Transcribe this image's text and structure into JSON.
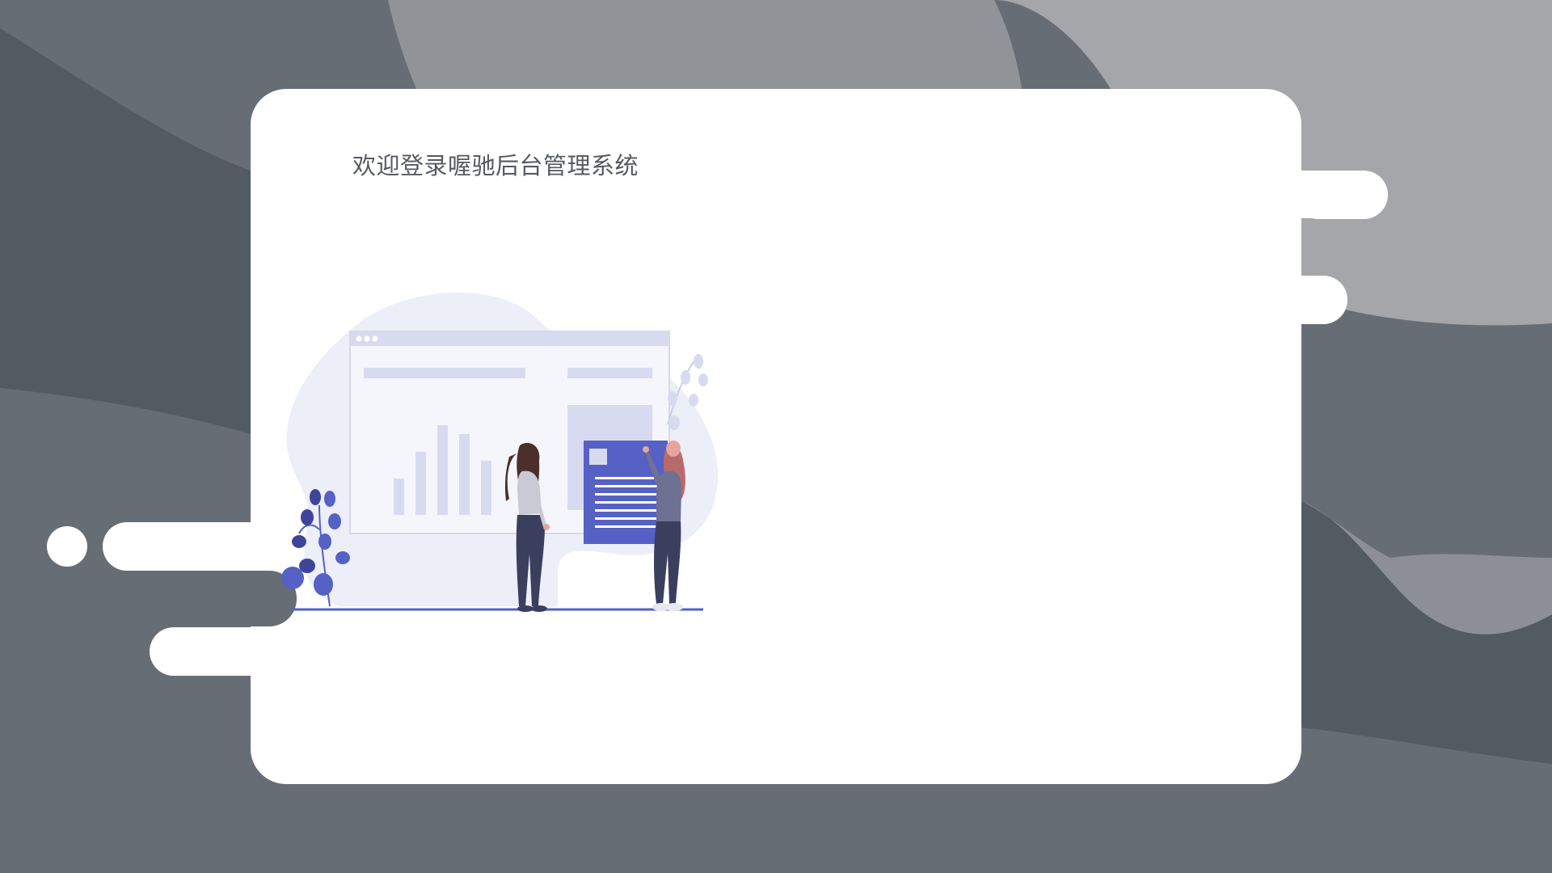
{
  "page": {
    "title": "欢迎登录喔驰后台管理系统"
  },
  "colors": {
    "background": "#676d75",
    "card": "#ffffff",
    "title_text": "#555a60",
    "accent_indigo": "#5561c4",
    "illustration_light": "#eceef8"
  },
  "illustration": {
    "name": "dashboard-presentation-illustration"
  }
}
